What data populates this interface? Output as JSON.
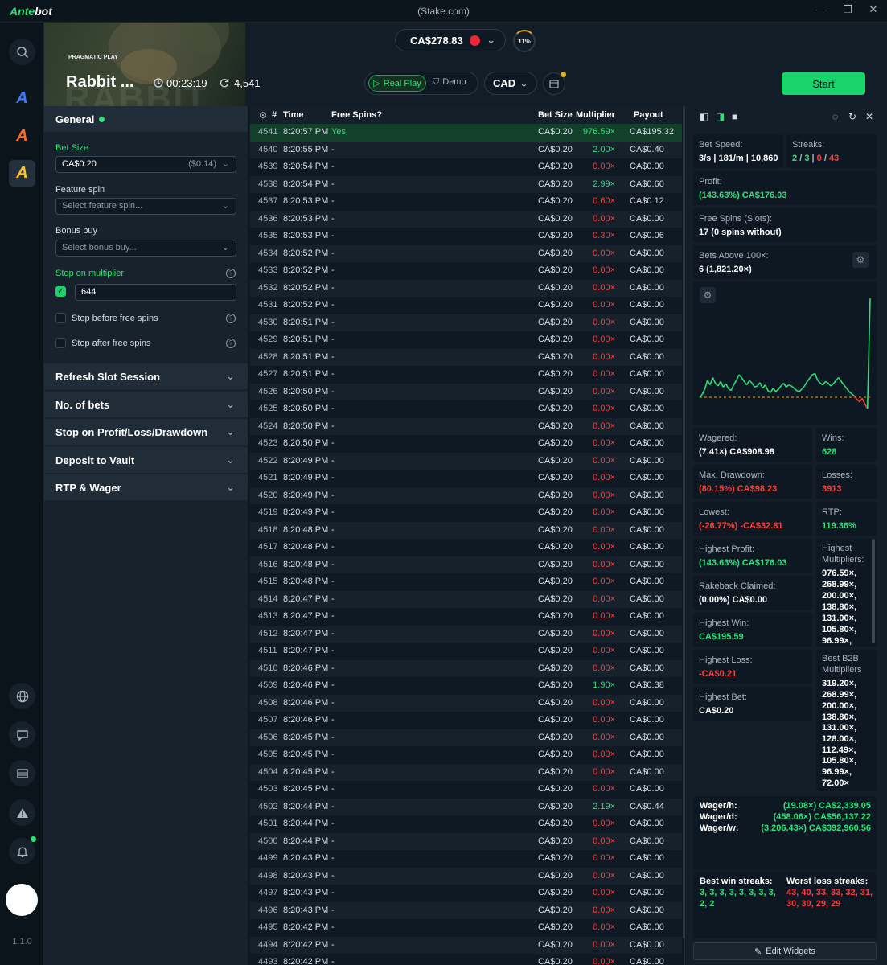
{
  "app": {
    "name_a": "Ante",
    "name_b": "bot",
    "window_title": "(Stake.com)",
    "version": "1.1.0"
  },
  "window_controls": {
    "minimize": "—",
    "maximize": "❐",
    "close": "✕"
  },
  "header": {
    "provider": "PRAGMATIC PLAY",
    "provider_badge": "PLAY",
    "game_title": "Rabbit ...",
    "hero_bg_text": "RABBIT",
    "timer": "00:23:19",
    "spin_count": "4,541",
    "balance": "CA$278.83",
    "progress_label": "11%",
    "mode_real": "Real Play",
    "mode_demo": "Demo",
    "currency": "CAD",
    "start_label": "Start"
  },
  "settings": {
    "general_title": "General",
    "bet_size_label": "Bet Size",
    "bet_size_value": "CA$0.20",
    "bet_size_alt": "($0.14)",
    "feature_spin_label": "Feature spin",
    "feature_spin_placeholder": "Select feature spin...",
    "bonus_buy_label": "Bonus buy",
    "bonus_buy_placeholder": "Select bonus buy...",
    "stop_mult_label": "Stop on multiplier",
    "stop_mult_value": "644",
    "stop_mult_checked": true,
    "stop_before_fs": "Stop before free spins",
    "stop_after_fs": "Stop after free spins",
    "sections": [
      "Refresh Slot Session",
      "No. of bets",
      "Stop on Profit/Loss/Drawdown",
      "Deposit to Vault",
      "RTP & Wager"
    ]
  },
  "table": {
    "headers": {
      "id": "#",
      "time": "Time",
      "free_spins": "Free Spins?",
      "bet_size": "Bet Size",
      "multiplier": "Multiplier",
      "payout": "Payout"
    },
    "rows": [
      [
        "4541",
        "8:20:57 PM",
        "Yes",
        "CA$0.20",
        "976.59×",
        "CA$195.32"
      ],
      [
        "4540",
        "8:20:55 PM",
        "-",
        "CA$0.20",
        "2.00×",
        "CA$0.40"
      ],
      [
        "4539",
        "8:20:54 PM",
        "-",
        "CA$0.20",
        "0.00×",
        "CA$0.00"
      ],
      [
        "4538",
        "8:20:54 PM",
        "-",
        "CA$0.20",
        "2.99×",
        "CA$0.60"
      ],
      [
        "4537",
        "8:20:53 PM",
        "-",
        "CA$0.20",
        "0.60×",
        "CA$0.12"
      ],
      [
        "4536",
        "8:20:53 PM",
        "-",
        "CA$0.20",
        "0.00×",
        "CA$0.00"
      ],
      [
        "4535",
        "8:20:53 PM",
        "-",
        "CA$0.20",
        "0.30×",
        "CA$0.06"
      ],
      [
        "4534",
        "8:20:52 PM",
        "-",
        "CA$0.20",
        "0.00×",
        "CA$0.00"
      ],
      [
        "4533",
        "8:20:52 PM",
        "-",
        "CA$0.20",
        "0.00×",
        "CA$0.00"
      ],
      [
        "4532",
        "8:20:52 PM",
        "-",
        "CA$0.20",
        "0.00×",
        "CA$0.00"
      ],
      [
        "4531",
        "8:20:52 PM",
        "-",
        "CA$0.20",
        "0.00×",
        "CA$0.00"
      ],
      [
        "4530",
        "8:20:51 PM",
        "-",
        "CA$0.20",
        "0.00×",
        "CA$0.00"
      ],
      [
        "4529",
        "8:20:51 PM",
        "-",
        "CA$0.20",
        "0.00×",
        "CA$0.00"
      ],
      [
        "4528",
        "8:20:51 PM",
        "-",
        "CA$0.20",
        "0.00×",
        "CA$0.00"
      ],
      [
        "4527",
        "8:20:51 PM",
        "-",
        "CA$0.20",
        "0.00×",
        "CA$0.00"
      ],
      [
        "4526",
        "8:20:50 PM",
        "-",
        "CA$0.20",
        "0.00×",
        "CA$0.00"
      ],
      [
        "4525",
        "8:20:50 PM",
        "-",
        "CA$0.20",
        "0.00×",
        "CA$0.00"
      ],
      [
        "4524",
        "8:20:50 PM",
        "-",
        "CA$0.20",
        "0.00×",
        "CA$0.00"
      ],
      [
        "4523",
        "8:20:50 PM",
        "-",
        "CA$0.20",
        "0.00×",
        "CA$0.00"
      ],
      [
        "4522",
        "8:20:49 PM",
        "-",
        "CA$0.20",
        "0.00×",
        "CA$0.00"
      ],
      [
        "4521",
        "8:20:49 PM",
        "-",
        "CA$0.20",
        "0.00×",
        "CA$0.00"
      ],
      [
        "4520",
        "8:20:49 PM",
        "-",
        "CA$0.20",
        "0.00×",
        "CA$0.00"
      ],
      [
        "4519",
        "8:20:49 PM",
        "-",
        "CA$0.20",
        "0.00×",
        "CA$0.00"
      ],
      [
        "4518",
        "8:20:48 PM",
        "-",
        "CA$0.20",
        "0.00×",
        "CA$0.00"
      ],
      [
        "4517",
        "8:20:48 PM",
        "-",
        "CA$0.20",
        "0.00×",
        "CA$0.00"
      ],
      [
        "4516",
        "8:20:48 PM",
        "-",
        "CA$0.20",
        "0.00×",
        "CA$0.00"
      ],
      [
        "4515",
        "8:20:48 PM",
        "-",
        "CA$0.20",
        "0.00×",
        "CA$0.00"
      ],
      [
        "4514",
        "8:20:47 PM",
        "-",
        "CA$0.20",
        "0.00×",
        "CA$0.00"
      ],
      [
        "4513",
        "8:20:47 PM",
        "-",
        "CA$0.20",
        "0.00×",
        "CA$0.00"
      ],
      [
        "4512",
        "8:20:47 PM",
        "-",
        "CA$0.20",
        "0.00×",
        "CA$0.00"
      ],
      [
        "4511",
        "8:20:47 PM",
        "-",
        "CA$0.20",
        "0.00×",
        "CA$0.00"
      ],
      [
        "4510",
        "8:20:46 PM",
        "-",
        "CA$0.20",
        "0.00×",
        "CA$0.00"
      ],
      [
        "4509",
        "8:20:46 PM",
        "-",
        "CA$0.20",
        "1.90×",
        "CA$0.38"
      ],
      [
        "4508",
        "8:20:46 PM",
        "-",
        "CA$0.20",
        "0.00×",
        "CA$0.00"
      ],
      [
        "4507",
        "8:20:46 PM",
        "-",
        "CA$0.20",
        "0.00×",
        "CA$0.00"
      ],
      [
        "4506",
        "8:20:45 PM",
        "-",
        "CA$0.20",
        "0.00×",
        "CA$0.00"
      ],
      [
        "4505",
        "8:20:45 PM",
        "-",
        "CA$0.20",
        "0.00×",
        "CA$0.00"
      ],
      [
        "4504",
        "8:20:45 PM",
        "-",
        "CA$0.20",
        "0.00×",
        "CA$0.00"
      ],
      [
        "4503",
        "8:20:45 PM",
        "-",
        "CA$0.20",
        "0.00×",
        "CA$0.00"
      ],
      [
        "4502",
        "8:20:44 PM",
        "-",
        "CA$0.20",
        "2.19×",
        "CA$0.44"
      ],
      [
        "4501",
        "8:20:44 PM",
        "-",
        "CA$0.20",
        "0.00×",
        "CA$0.00"
      ],
      [
        "4500",
        "8:20:44 PM",
        "-",
        "CA$0.20",
        "0.00×",
        "CA$0.00"
      ],
      [
        "4499",
        "8:20:43 PM",
        "-",
        "CA$0.20",
        "0.00×",
        "CA$0.00"
      ],
      [
        "4498",
        "8:20:43 PM",
        "-",
        "CA$0.20",
        "0.00×",
        "CA$0.00"
      ],
      [
        "4497",
        "8:20:43 PM",
        "-",
        "CA$0.20",
        "0.00×",
        "CA$0.00"
      ],
      [
        "4496",
        "8:20:43 PM",
        "-",
        "CA$0.20",
        "0.00×",
        "CA$0.00"
      ],
      [
        "4495",
        "8:20:42 PM",
        "-",
        "CA$0.20",
        "0.00×",
        "CA$0.00"
      ],
      [
        "4494",
        "8:20:42 PM",
        "-",
        "CA$0.20",
        "0.00×",
        "CA$0.00"
      ],
      [
        "4493",
        "8:20:42 PM",
        "-",
        "CA$0.20",
        "0.00×",
        "CA$0.00"
      ]
    ]
  },
  "stats": {
    "bet_speed_label": "Bet Speed:",
    "bet_speed_value": "3/s | 181/m | 10,860/h",
    "streaks_label": "Streaks:",
    "streaks_values": [
      "2",
      "3",
      "0",
      "43"
    ],
    "streaks_sep": "/",
    "profit_label": "Profit:",
    "profit_value": "(143.63%) CA$176.03",
    "free_spins_label": "Free Spins (Slots):",
    "free_spins_value": "17 (0 spins without)",
    "bets_above_label": "Bets Above 100×:",
    "bets_above_value": "6 (1,821.20×)",
    "wagered_label": "Wagered:",
    "wagered_value": "(7.41×) CA$908.98",
    "wins_label": "Wins:",
    "wins_value": "628",
    "max_dd_label": "Max. Drawdown:",
    "max_dd_value": "(80.15%) CA$98.23",
    "losses_label": "Losses:",
    "losses_value": "3913",
    "lowest_label": "Lowest:",
    "lowest_value": "(-26.77%) -CA$32.81",
    "rtp_label": "RTP:",
    "rtp_value": "119.36%",
    "highest_profit_label": "Highest Profit:",
    "highest_profit_value": "(143.63%) CA$176.03",
    "highest_mult_label": "Highest Multipliers:",
    "highest_mult_values": [
      "976.59×,",
      "268.99×,",
      "200.00×,",
      "138.80×,",
      "131.00×,",
      "105.80×,",
      "96.99×,"
    ],
    "rakeback_label": "Rakeback Claimed:",
    "rakeback_value": "(0.00%) CA$0.00",
    "highest_win_label": "Highest Win:",
    "highest_win_value": "CA$195.59",
    "highest_loss_label": "Highest Loss:",
    "highest_loss_value": "-CA$0.21",
    "highest_bet_label": "Highest Bet:",
    "highest_bet_value": "CA$0.20",
    "best_b2b_label": "Best B2B Multipliers",
    "best_b2b_values": [
      "319.20×,",
      "268.99×,",
      "200.00×,",
      "138.80×,",
      "131.00×,",
      "128.00×,",
      "112.49×,",
      "105.80×,",
      "96.99×,",
      "72.00×"
    ],
    "wager_h_label": "Wager/h:",
    "wager_h_value": "(19.08×) CA$2,339.05",
    "wager_d_label": "Wager/d:",
    "wager_d_value": "(458.06×) CA$56,137.22",
    "wager_w_label": "Wager/w:",
    "wager_w_value": "(3,206.43×) CA$392,960.56",
    "best_win_streaks_label": "Best win streaks:",
    "best_win_streaks_value": "3, 3, 3, 3, 3, 3, 3, 3, 2, 2",
    "worst_loss_streaks_label": "Worst loss streaks:",
    "worst_loss_streaks_value": "43, 40, 33, 33, 32, 31, 30, 30, 29, 29",
    "edit_widgets_label": "Edit Widgets"
  },
  "chart_data": {
    "type": "line",
    "description_series": "profit",
    "y": [
      0,
      5,
      15,
      30,
      22,
      35,
      25,
      20,
      28,
      18,
      24,
      15,
      12,
      22,
      30,
      40,
      35,
      28,
      22,
      30,
      25,
      18,
      20,
      26,
      16,
      22,
      12,
      8,
      16,
      10,
      14,
      20,
      25,
      18,
      22,
      20,
      16,
      12,
      10,
      15,
      20,
      28,
      34,
      40,
      42,
      30,
      25,
      22,
      28,
      25,
      20,
      24,
      30,
      35,
      28,
      22,
      16,
      10,
      6,
      2,
      -4,
      -8,
      -2,
      -12,
      -20,
      176
    ],
    "baseline": 0,
    "colors": {
      "above": "#2de07a",
      "below": "#ff3d3d"
    }
  },
  "colors": {
    "accent": "#19d46a",
    "danger": "#ff3d3d",
    "bg": "#0f1923"
  }
}
